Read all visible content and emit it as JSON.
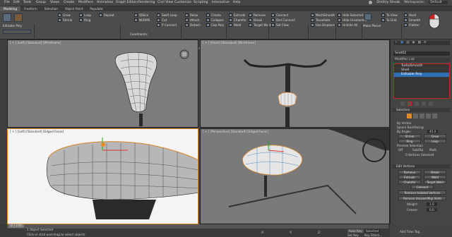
{
  "menu": {
    "items": [
      "File",
      "Edit",
      "Tools",
      "Group",
      "Views",
      "Create",
      "Modifiers",
      "Animation",
      "Graph Editors",
      "Rendering",
      "Civil View",
      "Customize",
      "Scripting",
      "Interactive",
      "Help"
    ],
    "user": "Dmitriy Shvab",
    "workspaces_label": "Workspaces:",
    "workspace_value": "Default"
  },
  "tabs": [
    "Modeling",
    "Freeform",
    "Selection",
    "Object Paint",
    "Populate"
  ],
  "ribbon": {
    "group1": "Polygon Modeling",
    "group2": "Modify Selection",
    "group3": "Edit",
    "group4": "Geometry (All)",
    "group5": "Vertices",
    "group6": "Loops",
    "group7": "Subdivision",
    "group8": "Visibility",
    "group9": "Align",
    "group10": "Properties",
    "sub_label": "Editable Poly",
    "btns": {
      "grow": "Grow",
      "shrink": "Shrink",
      "loop": "Loop",
      "ring": "Ring",
      "repeat": "Repeat",
      "qslice": "QSlice",
      "swiftloop": "Swift Loop",
      "navigator": "NURMS",
      "cut": "Cut",
      "pp": "P Connect",
      "constraints": "Constraints:",
      "relax": "Relax",
      "attach": "Attach",
      "collapse": "Collapse",
      "detach": "Detach",
      "capply": "Cap Poly",
      "create": "Create",
      "extrude": "Extrude",
      "chamfer": "Chamfer",
      "weld": "Weld",
      "target": "Target Weld",
      "remove": "Remove",
      "break": "Break",
      "connect": "Connect",
      "setflow": "Set Flow",
      "distconnect": "Dist Connect",
      "meshsmooth": "MeshSmooth",
      "tessellate": "Tessellate",
      "useDisp": "Use Displace",
      "hidesel": "Hide Selected",
      "hideunsel": "Hide Unselected",
      "unhideall": "Unhide All",
      "tox": "To View",
      "togrid": "To Grid",
      "hard": "Hard",
      "smooth": "Smooth",
      "flatten": "Flatten",
      "planar": "Make Planar"
    }
  },
  "viewports": {
    "top_left": "[ + ] [Left] [Standard] [Wireframe]",
    "top_right": "[ + ] [Front] [Standard] [Wireframe]",
    "bottom_left": "[ + ] [Left] [Standard] [Edged Faces]",
    "bottom_right": "[ + ] [Perspective] [Standard] [Edged Faces]"
  },
  "command_panel": {
    "object_name": "Seat02",
    "modifier_list_label": "Modifier List",
    "stack": [
      "TurboSmooth",
      "Shell",
      "Editable Poly"
    ],
    "selection_header": "Selection",
    "by_vertex": "By Vertex",
    "ignore_backfacing": "Ignore Backfacing",
    "by_angle": "By Angle:",
    "angle_value": "45.0",
    "shrink": "Shrink",
    "grow": "Grow",
    "ring": "Ring",
    "loop": "Loop",
    "preview_selection": "Preview Selection",
    "off": "Off",
    "subobj": "SubObj",
    "multi": "Multi",
    "selected_count": "0 Vertices Selected",
    "edit_vertices_header": "Edit Vertices",
    "remove": "Remove",
    "break": "Break",
    "extrude": "Extrude",
    "weld": "Weld",
    "chamfer": "Chamfer",
    "target_weld": "Target Weld",
    "connect": "Connect",
    "remove_isolated": "Remove Isolated Vertices",
    "remove_unused": "Remove Unused Map Verts",
    "weight_label": "Weight:",
    "weight_value": "1.0",
    "crease_label": "Crease:",
    "crease_value": "0.0"
  },
  "timeline": {
    "frame": "0 / 100",
    "status_selected": "1 Object Selected",
    "status_hint": "Click or click-and-drag to select objects",
    "x_label": "X:",
    "y_label": "Y:",
    "z_label": "Z:",
    "auto_key": "Auto Key",
    "selected": "Selected",
    "set_key": "Set Key",
    "key_filters": "Key Filters...",
    "add_time_tag": "Add Time Tag"
  },
  "colors": {
    "accent_blue": "#2c6fb5",
    "orange": "#e08a2a",
    "selection_red": "#cc2222"
  }
}
